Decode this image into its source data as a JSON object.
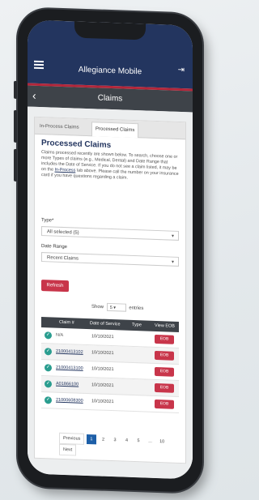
{
  "app": {
    "title": "Allegiance Mobile",
    "page_title": "Claims",
    "accent_color": "#23355f",
    "brand_red": "#c8354a"
  },
  "tabs": [
    {
      "label": "In-Process Claims",
      "active": false
    },
    {
      "label": "Processed Claims",
      "active": true
    }
  ],
  "section": {
    "heading": "Processed Claims",
    "description_pre": "Claims processed recently are shown below. To search, choose one or more Types of claims (e.g., Medical, Dental) and Date Range that includes the Date of Service. If you do not see a claim listed, it may be on the ",
    "description_link": "In-Process",
    "description_post": " tab above. Please call the number on your insurance card if you have questions regarding a claim."
  },
  "filters": {
    "type_label": "Type*",
    "type_value": "All selected (5)",
    "date_label": "Date Range",
    "date_value": "Recent Claims"
  },
  "refresh_label": "Refresh",
  "show": {
    "prefix": "Show",
    "value": "5",
    "suffix": "entries"
  },
  "table": {
    "headers": [
      "Claim #",
      "Date of Service",
      "Type",
      "View EOB"
    ],
    "rows": [
      {
        "claim": "N/A",
        "date": "10/10/2021",
        "eob": "EOB"
      },
      {
        "claim": "21000413102",
        "date": "10/10/2021",
        "eob": "EOB"
      },
      {
        "claim": "21000413100",
        "date": "10/10/2021",
        "eob": "EOB"
      },
      {
        "claim": "A01866100",
        "date": "10/10/2021",
        "eob": "EOB"
      },
      {
        "claim": "21000608300",
        "date": "10/10/2021",
        "eob": "EOB"
      }
    ]
  },
  "pagination": {
    "previous": "Previous",
    "pages": [
      "1",
      "2",
      "3",
      "4",
      "5",
      "...",
      "10"
    ],
    "next": "Next",
    "active": "1"
  }
}
